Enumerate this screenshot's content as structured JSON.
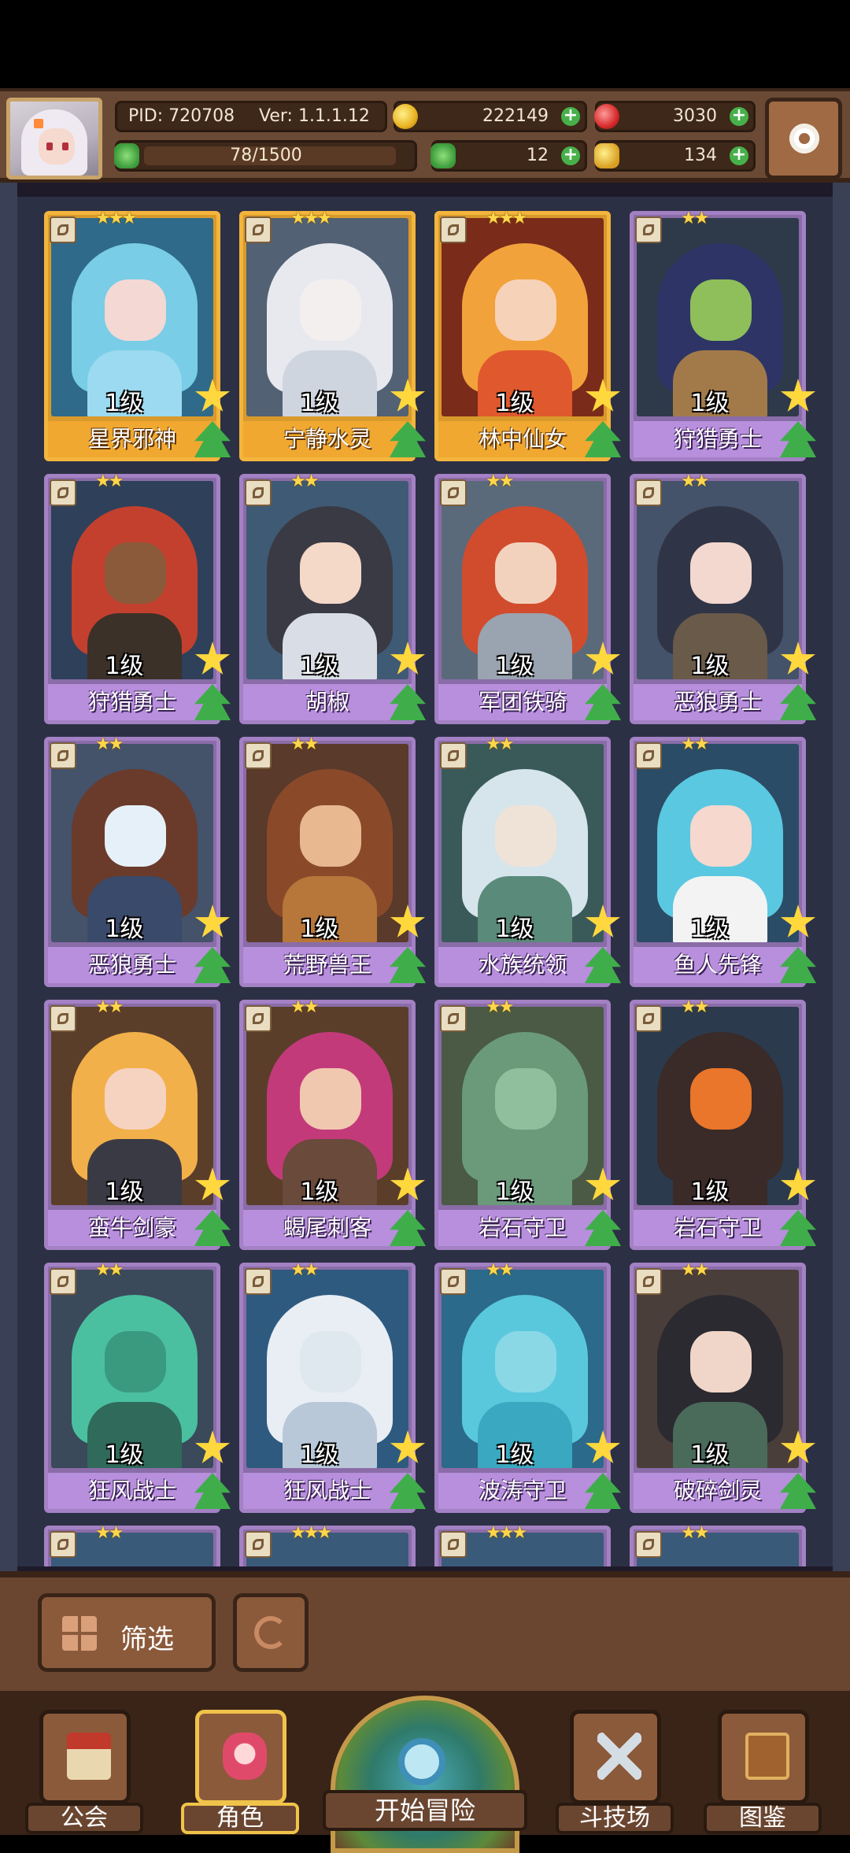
{
  "top_bar": {
    "pid": "PID: 720708",
    "version": "Ver: 1.1.1.12",
    "stamina": "78/1500",
    "gold": "222149",
    "gems": "3030",
    "clovers": "12",
    "keys": "134",
    "plus_label": "+"
  },
  "cards": [
    {
      "name": "星界邪神",
      "level": "1级",
      "stars": "★★★",
      "frame": "gold"
    },
    {
      "name": "宁静水灵",
      "level": "1级",
      "stars": "★★★",
      "frame": "gold"
    },
    {
      "name": "林中仙女",
      "level": "1级",
      "stars": "★★★",
      "frame": "gold"
    },
    {
      "name": "狩猎勇士",
      "level": "1级",
      "stars": "★★",
      "frame": "purple"
    },
    {
      "name": "狩猎勇士",
      "level": "1级",
      "stars": "★★",
      "frame": "purple"
    },
    {
      "name": "胡椒",
      "level": "1级",
      "stars": "★★",
      "frame": "purple"
    },
    {
      "name": "军团铁骑",
      "level": "1级",
      "stars": "★★",
      "frame": "purple"
    },
    {
      "name": "恶狼勇士",
      "level": "1级",
      "stars": "★★",
      "frame": "purple"
    },
    {
      "name": "恶狼勇士",
      "level": "1级",
      "stars": "★★",
      "frame": "purple"
    },
    {
      "name": "荒野兽王",
      "level": "1级",
      "stars": "★★",
      "frame": "purple"
    },
    {
      "name": "水族统领",
      "level": "1级",
      "stars": "★★",
      "frame": "purple"
    },
    {
      "name": "鱼人先锋",
      "level": "1级",
      "stars": "★★",
      "frame": "purple"
    },
    {
      "name": "蛮牛剑豪",
      "level": "1级",
      "stars": "★★",
      "frame": "purple"
    },
    {
      "name": "蝎尾刺客",
      "level": "1级",
      "stars": "★★",
      "frame": "purple"
    },
    {
      "name": "岩石守卫",
      "level": "1级",
      "stars": "★★",
      "frame": "purple"
    },
    {
      "name": "岩石守卫",
      "level": "1级",
      "stars": "★★",
      "frame": "purple"
    },
    {
      "name": "狂风战士",
      "level": "1级",
      "stars": "★★",
      "frame": "purple"
    },
    {
      "name": "狂风战士",
      "level": "1级",
      "stars": "★★",
      "frame": "purple"
    },
    {
      "name": "波涛守卫",
      "level": "1级",
      "stars": "★★",
      "frame": "purple"
    },
    {
      "name": "破碎剑灵",
      "level": "1级",
      "stars": "★★",
      "frame": "purple"
    }
  ],
  "partial_row_stars": [
    "★★",
    "★★★",
    "★★★",
    "★★"
  ],
  "filter": {
    "label": "筛选"
  },
  "nav": {
    "guild": "公会",
    "character": "角色",
    "adventure": "开始冒险",
    "arena": "斗技场",
    "codex": "图鉴"
  },
  "colors": {
    "gold_frame": "#f3b53d",
    "purple_frame": "#a381c4",
    "accent_green": "#3fae4a",
    "star_yellow": "#ffd83d"
  }
}
